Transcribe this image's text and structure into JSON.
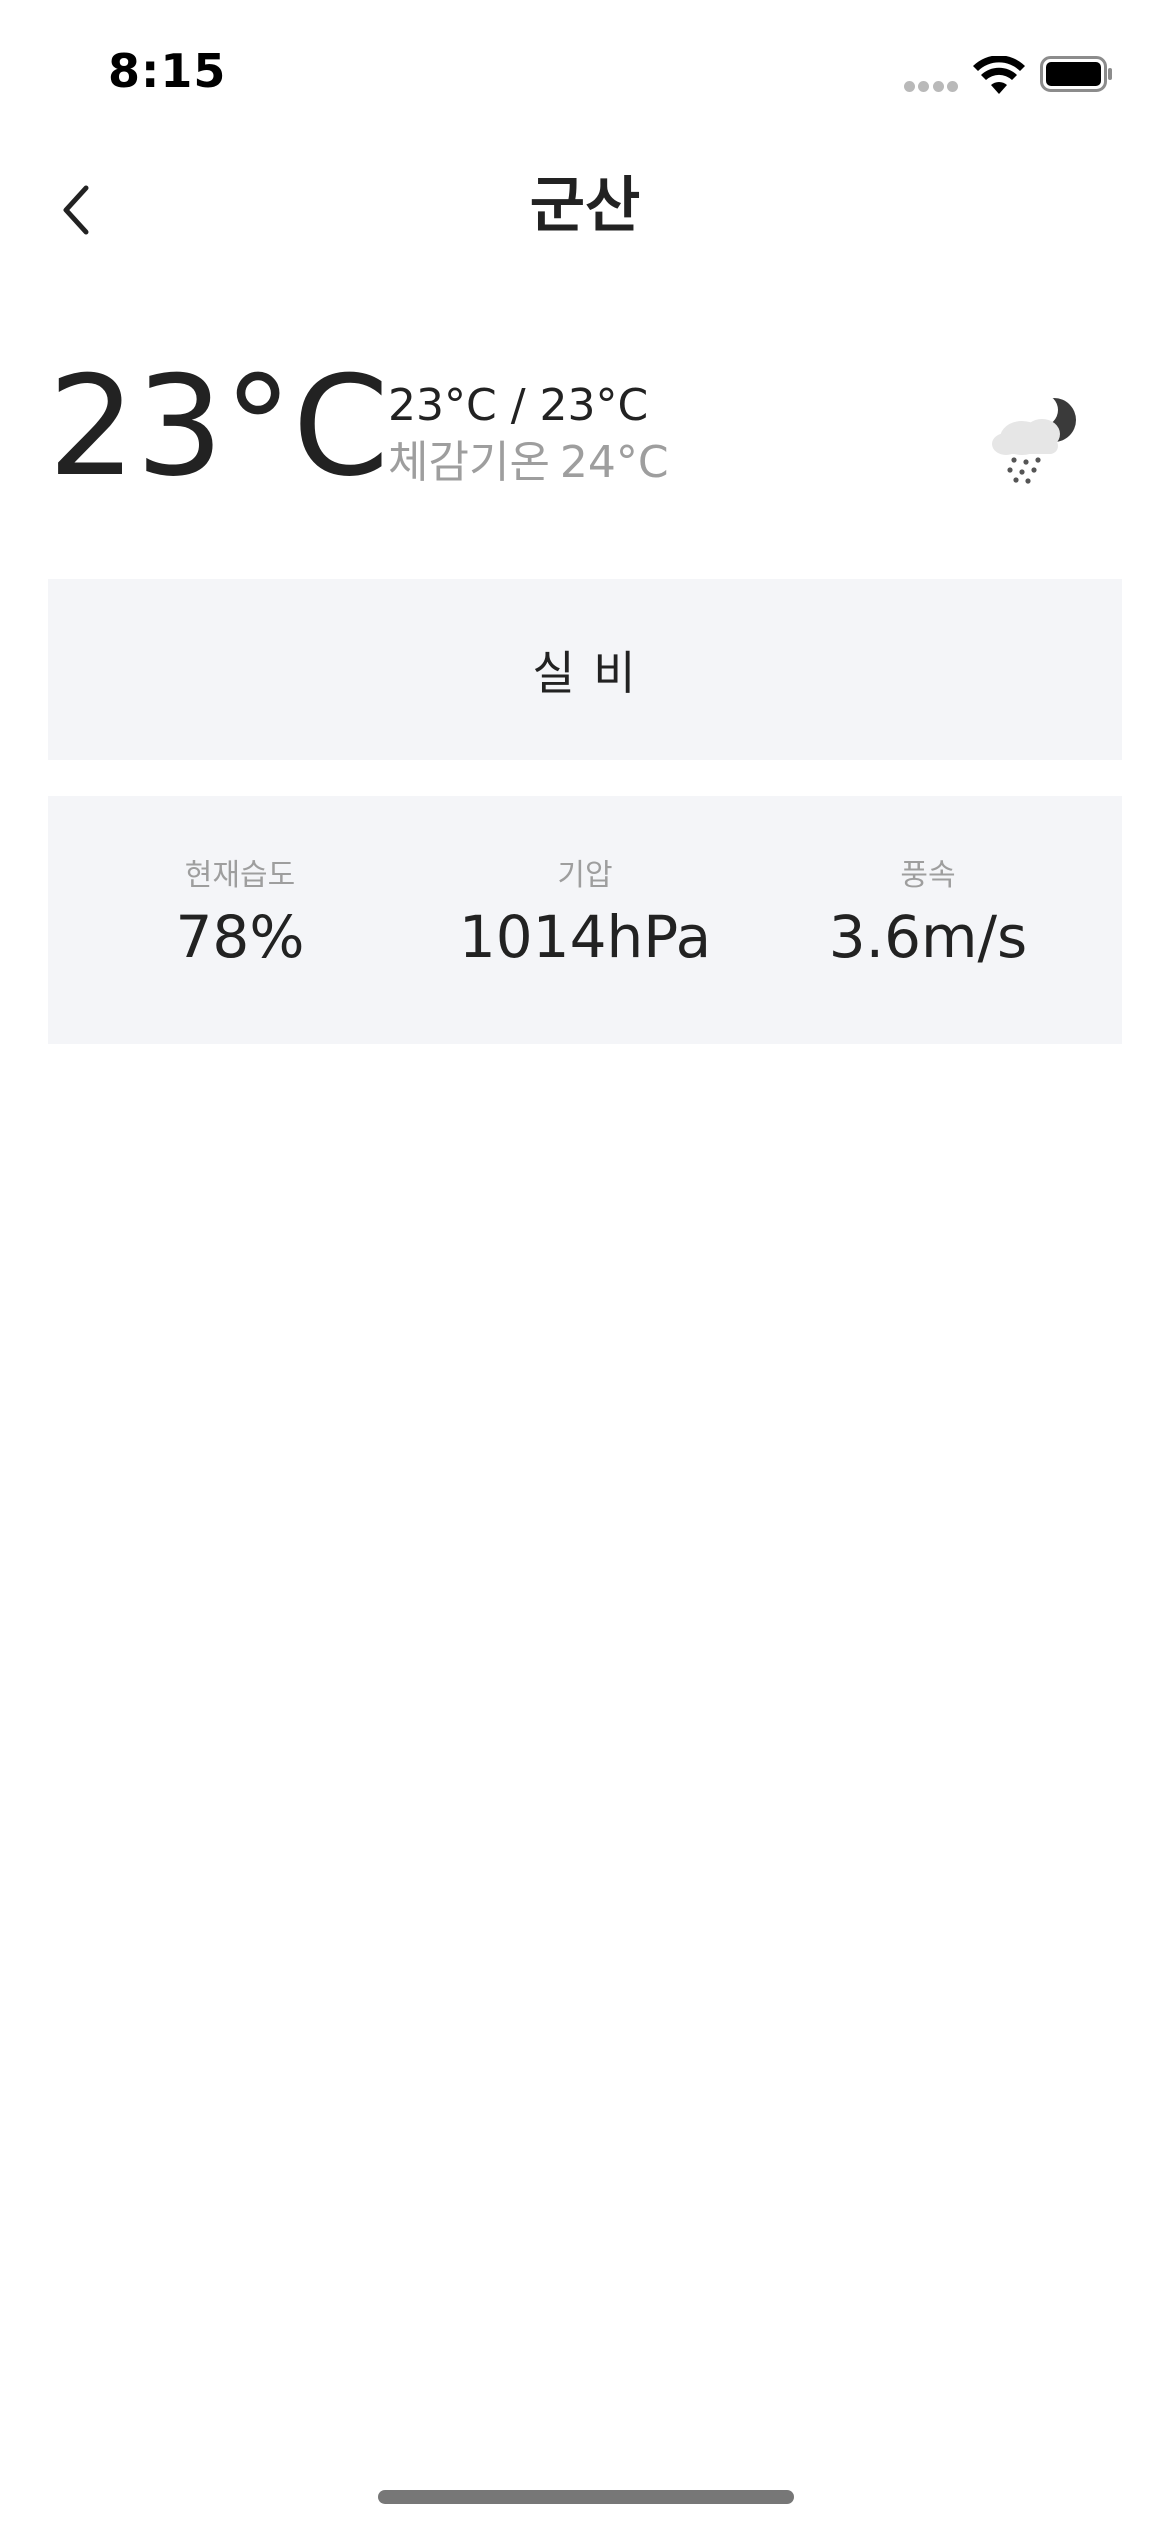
{
  "status_bar": {
    "time": "8:15",
    "icons": [
      "signal-dots-icon",
      "wifi-icon",
      "battery-icon"
    ]
  },
  "header": {
    "back_icon": "chevron-left-icon",
    "title": "군산"
  },
  "current": {
    "temperature": "23°C",
    "range": "23°C / 23°C",
    "feels_like_label": "체감기온",
    "feels_like_value": "24°C",
    "weather_icon": "night-rain-cloud-moon-icon",
    "condition": "실 비"
  },
  "stats": {
    "humidity": {
      "label": "현재습도",
      "value": "78%"
    },
    "pressure": {
      "label": "기압",
      "value": "1014hPa"
    },
    "wind": {
      "label": "풍속",
      "value": "3.6m/s"
    }
  },
  "colors": {
    "primary_text": "#222222",
    "secondary_text": "#9e9e9e",
    "panel_background": "#f4f5f8",
    "background": "#ffffff"
  }
}
